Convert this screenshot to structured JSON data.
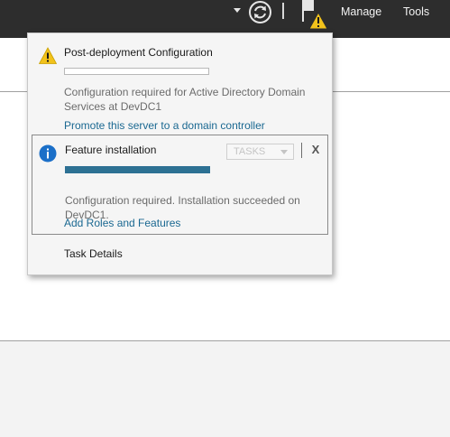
{
  "header": {
    "menu": [
      "Manage",
      "Tools"
    ],
    "icons": [
      "dropdown-arrow-icon",
      "refresh-icon",
      "notification-flag-icon",
      "warning-icon"
    ],
    "background_color": "#2d2d2d"
  },
  "notifications": [
    {
      "icon": "warning-icon",
      "title": "Post-deployment Configuration",
      "progress": 0,
      "description": "Configuration required for Active Directory Domain Services at DevDC1",
      "link": "Promote this server to a domain controller"
    },
    {
      "icon": "info-icon",
      "title": "Feature installation",
      "progress": 1.0,
      "tasks_label": "TASKS",
      "close_label": "X",
      "description": "Configuration required. Installation succeeded on DevDC1.",
      "link": "Add Roles and Features"
    }
  ],
  "footer_link": "Task Details",
  "colors": {
    "link": "#1a6891",
    "progress_fill": "#2d7193",
    "warning": "#f2c21b",
    "info": "#1b6fc8"
  }
}
